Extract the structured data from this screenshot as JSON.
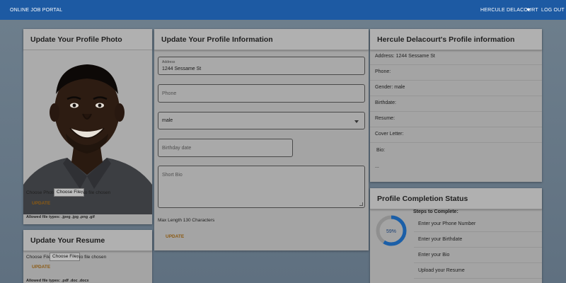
{
  "navbar": {
    "brand": "ONLINE JOB PORTAL",
    "user_name": "HERCULE DELACOURT",
    "logout": "LOG OUT"
  },
  "photo_card": {
    "title": "Update Your Profile Photo",
    "choose_label": "Choose Photo",
    "choose_button": "Choose File",
    "no_file": "No file chosen",
    "update": "UPDATE",
    "allowed": "Allowed file types: .jpeg .jpg .png .gif"
  },
  "resume_card": {
    "title": "Update Your Resume",
    "choose_label": "Choose File",
    "choose_button": "Choose File",
    "no_file": "No file chosen",
    "update": "UPDATE",
    "allowed": "Allowed file types: .pdf .doc .docx"
  },
  "profile_form": {
    "title": "Update Your Profile Information",
    "address_label": "Address",
    "address_value": "1244 Sessame St",
    "phone_placeholder": "Phone",
    "gender_value": "male",
    "birthday_placeholder": "Birthday date",
    "bio_placeholder": "Short Bio",
    "max_length_note": "Max Length 130 Characters",
    "update": "UPDATE"
  },
  "profile_info": {
    "title": "Hercule Delacourt's Profile information",
    "rows": [
      "Address: 1244 Sessame St",
      "Phone:",
      "Gender: male",
      "Birthdate:",
      "Resume:",
      "Cover Letter:",
      "Bio:",
      "..."
    ]
  },
  "completion": {
    "title": "Profile Completion Status",
    "percent_label": "59%",
    "percent": 59,
    "steps_title": "Steps to Complete:",
    "steps": [
      "Enter your Phone Number",
      "Enter your Birthdate",
      "Enter your Bio",
      "Upload your Resume"
    ],
    "ring_color": "#1b5fa8"
  }
}
